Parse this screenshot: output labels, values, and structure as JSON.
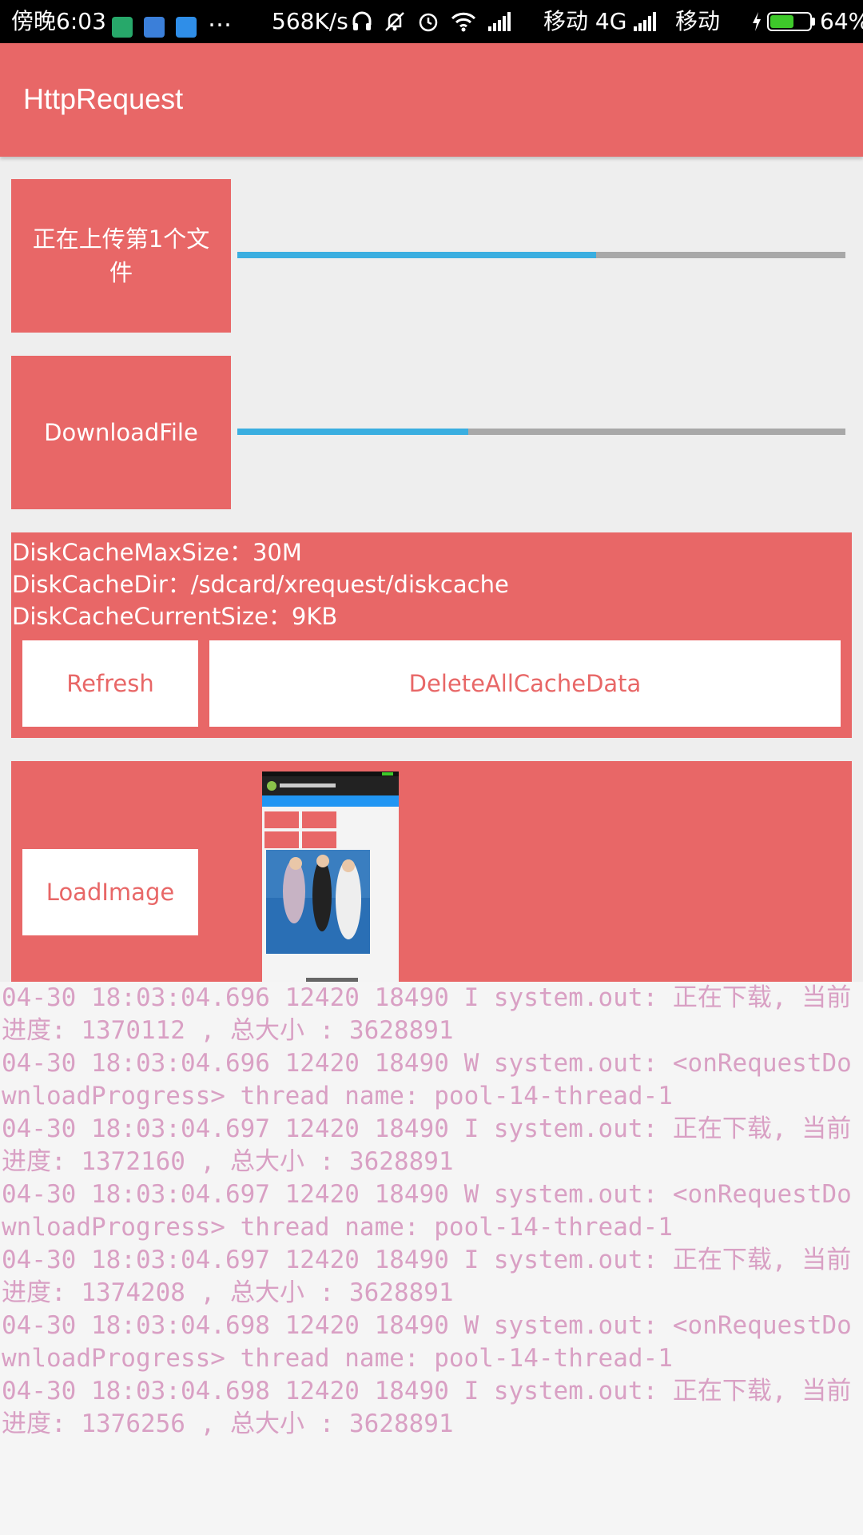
{
  "status_bar": {
    "time": "傍晚6:03",
    "more": "…",
    "speed": "568K/s",
    "carrier1": "移动 4G",
    "carrier2": "移动",
    "battery": "64%",
    "battery_level": 0.64
  },
  "app_bar": {
    "title": "HttpRequest"
  },
  "upload": {
    "label": "正在上传第1个文件",
    "progress": 0.59
  },
  "download": {
    "label": "DownloadFile",
    "progress": 0.38
  },
  "cache": {
    "lines": [
      "DiskCacheMaxSize：30M",
      "DiskCacheDir：/sdcard/xrequest/diskcache",
      "DiskCacheCurrentSize：9KB"
    ],
    "refresh_label": "Refresh",
    "delete_label": "DeleteAllCacheData"
  },
  "image_section": {
    "button_label": "LoadImage"
  },
  "log": [
    "04-30 18:03:04.696 12420 18490 I system.out: 正在下载, 当前进度: 1370112 , 总大小 : 3628891",
    "04-30 18:03:04.696 12420 18490 W system.out: <onRequestDownloadProgress> thread name: pool-14-thread-1",
    "04-30 18:03:04.697 12420 18490 I system.out: 正在下载, 当前进度: 1372160 , 总大小 : 3628891",
    "04-30 18:03:04.697 12420 18490 W system.out: <onRequestDownloadProgress> thread name: pool-14-thread-1",
    "04-30 18:03:04.697 12420 18490 I system.out: 正在下载, 当前进度: 1374208 , 总大小 : 3628891",
    "04-30 18:03:04.698 12420 18490 W system.out: <onRequestDownloadProgress> thread name: pool-14-thread-1",
    "04-30 18:03:04.698 12420 18490 I system.out: 正在下载, 当前进度: 1376256 , 总大小 : 3628891"
  ]
}
